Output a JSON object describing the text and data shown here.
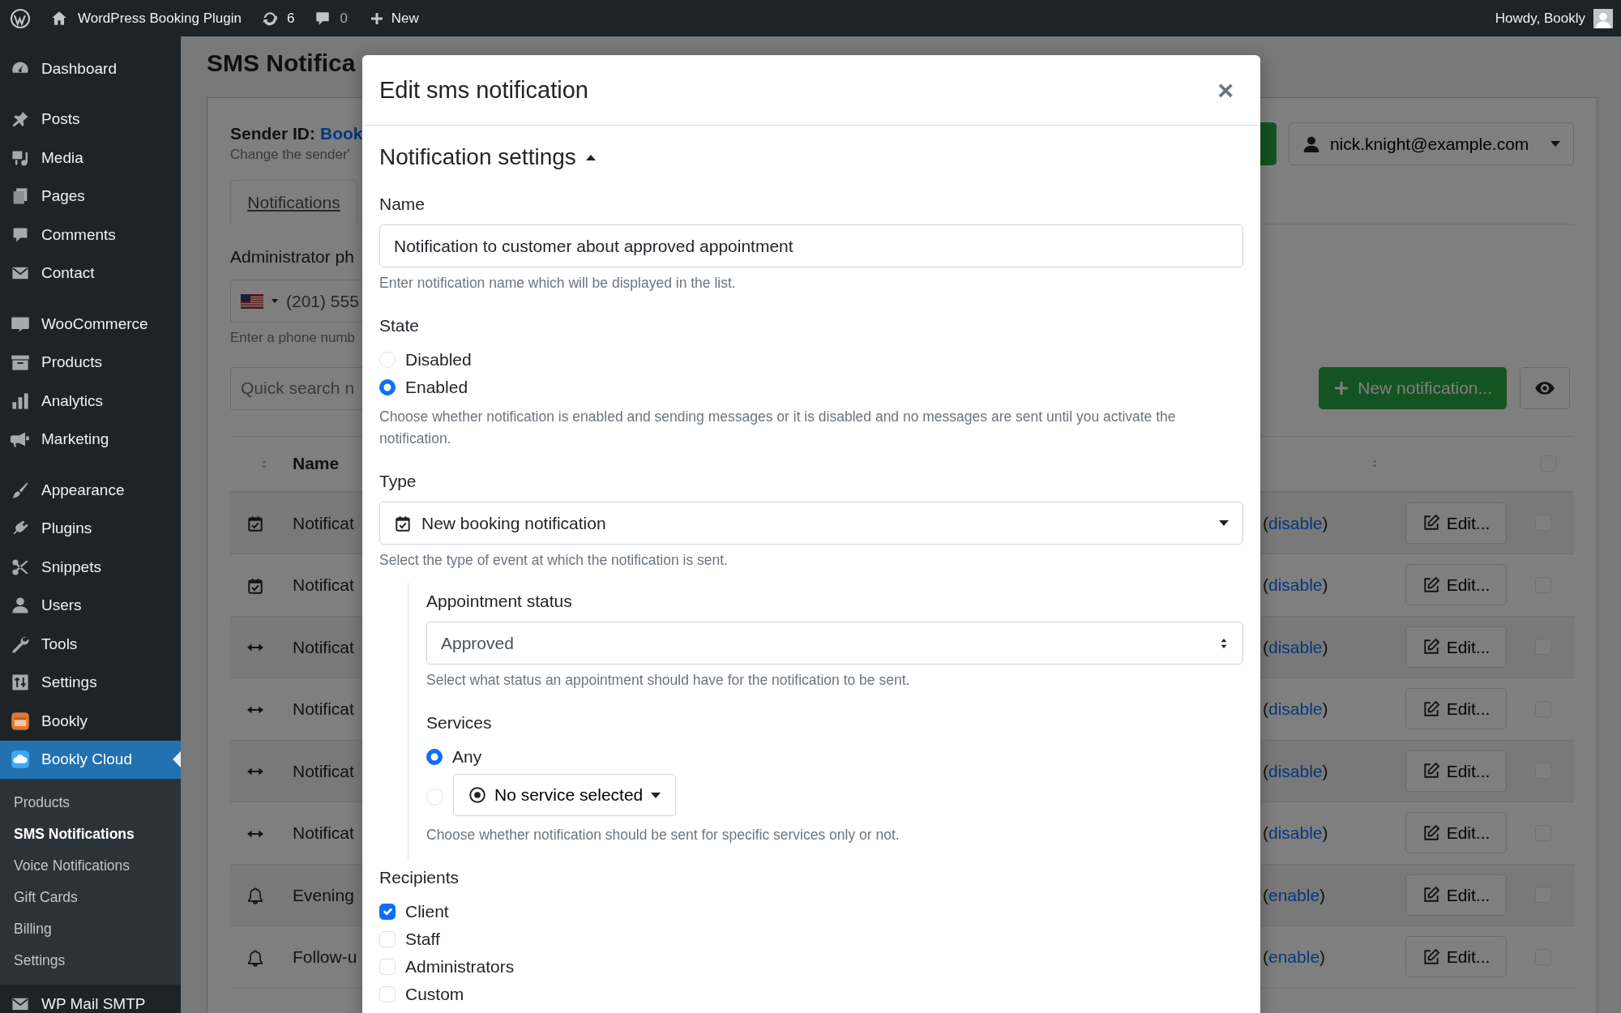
{
  "admin_bar": {
    "site_title": "WordPress Booking Plugin",
    "updates": "6",
    "comments": "0",
    "new_label": "New",
    "greeting": "Howdy, Bookly"
  },
  "sidebar": {
    "groups": [
      [
        {
          "label": "Dashboard",
          "selected": false
        }
      ],
      [
        {
          "label": "Posts",
          "selected": false
        },
        {
          "label": "Media",
          "selected": false
        },
        {
          "label": "Pages",
          "selected": false
        },
        {
          "label": "Comments",
          "selected": false
        },
        {
          "label": "Contact",
          "selected": false
        }
      ],
      [
        {
          "label": "WooCommerce",
          "selected": false
        },
        {
          "label": "Products",
          "selected": false
        },
        {
          "label": "Analytics",
          "selected": false
        },
        {
          "label": "Marketing",
          "selected": false
        }
      ],
      [
        {
          "label": "Appearance",
          "selected": false
        },
        {
          "label": "Plugins",
          "selected": false
        },
        {
          "label": "Snippets",
          "selected": false
        },
        {
          "label": "Users",
          "selected": false
        },
        {
          "label": "Tools",
          "selected": false
        },
        {
          "label": "Settings",
          "selected": false
        },
        {
          "label": "Bookly",
          "selected": false
        },
        {
          "label": "Bookly Cloud",
          "selected": true,
          "children": [
            {
              "label": "Products",
              "selected": false
            },
            {
              "label": "SMS Notifications",
              "selected": true
            },
            {
              "label": "Voice Notifications",
              "selected": false
            },
            {
              "label": "Gift Cards",
              "selected": false
            },
            {
              "label": "Billing",
              "selected": false
            },
            {
              "label": "Settings",
              "selected": false
            }
          ]
        }
      ],
      [
        {
          "label": "WP Mail SMTP",
          "selected": false
        }
      ]
    ]
  },
  "page": {
    "title": "SMS Notifica",
    "sender_label": "Sender ID:",
    "sender_value": "Book",
    "sender_help": "Change the sender'",
    "account": "nick.knight@example.com",
    "tabs": [
      {
        "label": "Notifications",
        "selected": true
      }
    ],
    "phone_label": "Administrator ph",
    "phone_value": "(201) 555",
    "phone_help": "Enter a phone numb",
    "search_placeholder": "Quick search n",
    "new_button": "New notification...",
    "table": {
      "columns": [
        "Name"
      ],
      "all_checked": false,
      "rows": [
        {
          "kind": "booking",
          "name": "Notificat",
          "action_prefix": "(",
          "action": "disable",
          "action_suffix": ")",
          "edit": "Edit...",
          "checked": false
        },
        {
          "kind": "booking",
          "name": "Notificat",
          "action_prefix": "(",
          "action": "disable",
          "action_suffix": ")",
          "edit": "Edit...",
          "checked": false
        },
        {
          "kind": "change",
          "name": "Notificat",
          "action_prefix": "(",
          "action": "disable",
          "action_suffix": ")",
          "edit": "Edit...",
          "checked": false
        },
        {
          "kind": "change",
          "name": "Notificat",
          "action_prefix": "(",
          "action": "disable",
          "action_suffix": ")",
          "edit": "Edit...",
          "checked": false
        },
        {
          "kind": "change",
          "name": "Notificat",
          "action_prefix": "(",
          "action": "disable",
          "action_suffix": ")",
          "edit": "Edit...",
          "checked": false
        },
        {
          "kind": "change",
          "name": "Notificat",
          "action_prefix": "(",
          "action": "disable",
          "action_suffix": ")",
          "edit": "Edit...",
          "checked": false
        },
        {
          "kind": "reminder",
          "name": "Evening",
          "action_prefix": "(",
          "action": "enable",
          "action_suffix": ")",
          "edit": "Edit...",
          "checked": false
        },
        {
          "kind": "reminder",
          "name": "Follow-u",
          "action_prefix": "(",
          "action": "enable",
          "action_suffix": ")",
          "edit": "Edit...",
          "checked": false
        }
      ]
    }
  },
  "modal": {
    "title": "Edit sms notification",
    "close": "×",
    "section_title": "Notification settings",
    "section_expanded": true,
    "name_field": {
      "label": "Name",
      "value": "Notification to customer about approved appointment",
      "help": "Enter notification name which will be displayed in the list."
    },
    "state": {
      "label": "State",
      "options": [
        {
          "label": "Disabled",
          "selected": false
        },
        {
          "label": "Enabled",
          "selected": true
        }
      ],
      "help": "Choose whether notification is enabled and sending messages or it is disabled and no messages are sent until you activate the notification."
    },
    "type": {
      "label": "Type",
      "value": "New booking notification",
      "help": "Select the type of event at which the notification is sent."
    },
    "appointment_status": {
      "label": "Appointment status",
      "value": "Approved",
      "help": "Select what status an appointment should have for the notification to be sent."
    },
    "services": {
      "label": "Services",
      "options": [
        {
          "kind": "plain",
          "label": "Any",
          "selected": true
        },
        {
          "kind": "dropdown",
          "label": "No service selected",
          "selected": false
        }
      ],
      "help": "Choose whether notification should be sent for specific services only or not."
    },
    "recipients": {
      "label": "Recipients",
      "options": [
        {
          "label": "Client",
          "checked": true
        },
        {
          "label": "Staff",
          "checked": false
        },
        {
          "label": "Administrators",
          "checked": false
        },
        {
          "label": "Custom",
          "checked": false
        }
      ]
    }
  }
}
